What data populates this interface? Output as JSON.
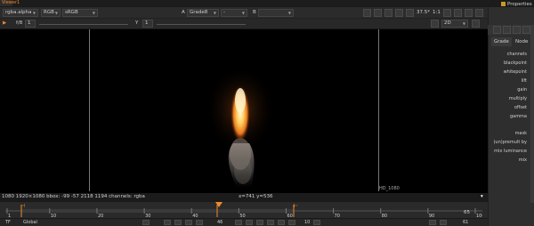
{
  "window": {
    "viewer_tab": "Viewer1",
    "properties_tab": "Properties"
  },
  "toolbar1": {
    "channels": "rgba.alpha",
    "colorspace_channel": "RGB",
    "display_lut": "sRGB",
    "input_a_label": "A",
    "input_a": "Grade8",
    "operator": "-",
    "input_b_label": "B",
    "input_b": "",
    "zoom": "37.5*",
    "ratio": "1:1"
  },
  "toolbar2": {
    "frame_label": "f/8",
    "gain": "1",
    "gamma_label": "Y",
    "gamma": "1",
    "view_mode": "2D"
  },
  "viewer": {
    "format_label": "HD_1080"
  },
  "infobar": {
    "info": "1080 1920×1080  bbox: -99 -57 2118 1194 channels: rgba",
    "coords": "x=741 y=536"
  },
  "timeline": {
    "ticks": [
      "1",
      "10",
      "20",
      "30",
      "40",
      "50",
      "60",
      "70",
      "80",
      "90",
      "100"
    ],
    "current_frame": "65",
    "range_start": "5",
    "range_end": "60",
    "playhead_frame": "46"
  },
  "transport": {
    "fps_label": "TF",
    "fps_mode": "Global",
    "frame_field": "46",
    "step": "10",
    "end_frame": "61"
  },
  "properties": {
    "tabs": [
      "Grade",
      "Node"
    ],
    "rows": [
      "channels",
      "blackpoint",
      "whitepoint",
      "lift",
      "gain",
      "multiply",
      "offset",
      "gamma",
      "",
      "mask",
      "(un)premult by",
      "mix luminance",
      "mix"
    ]
  },
  "colors": {
    "accent": "#f08a2a",
    "panel_bg": "#2e2e2e",
    "viewer_bg": "#000000"
  }
}
